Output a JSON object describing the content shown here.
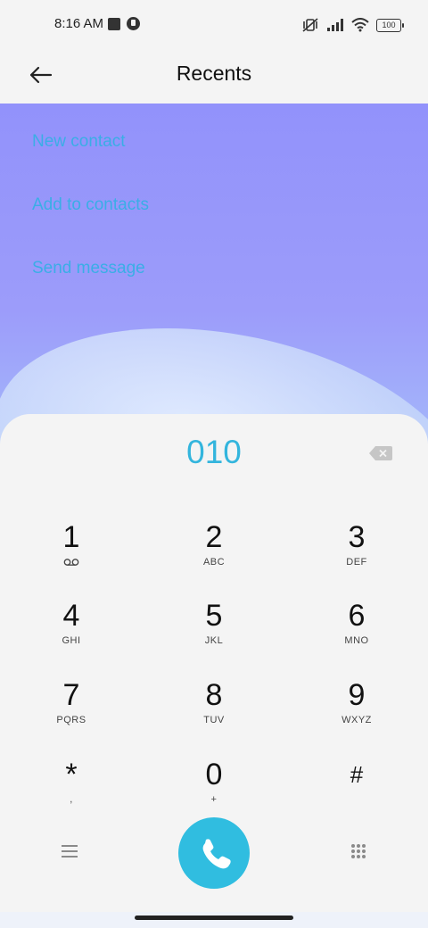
{
  "status_bar": {
    "time": "8:16 AM",
    "battery": "100"
  },
  "app_bar": {
    "title": "Recents"
  },
  "menu": [
    {
      "label": "New contact"
    },
    {
      "label": "Add to contacts"
    },
    {
      "label": "Send message"
    }
  ],
  "dialer": {
    "number": "010",
    "keys": [
      {
        "digit": "1",
        "letters": ""
      },
      {
        "digit": "2",
        "letters": "ABC"
      },
      {
        "digit": "3",
        "letters": "DEF"
      },
      {
        "digit": "4",
        "letters": "GHI"
      },
      {
        "digit": "5",
        "letters": "JKL"
      },
      {
        "digit": "6",
        "letters": "MNO"
      },
      {
        "digit": "7",
        "letters": "PQRS"
      },
      {
        "digit": "8",
        "letters": "TUV"
      },
      {
        "digit": "9",
        "letters": "WXYZ"
      },
      {
        "digit": "*",
        "letters": ","
      },
      {
        "digit": "0",
        "letters": "+"
      },
      {
        "digit": "#",
        "letters": ""
      }
    ]
  },
  "colors": {
    "accent": "#33b5dd",
    "menu_text": "#3aaee6",
    "call_button": "#30bde0"
  }
}
